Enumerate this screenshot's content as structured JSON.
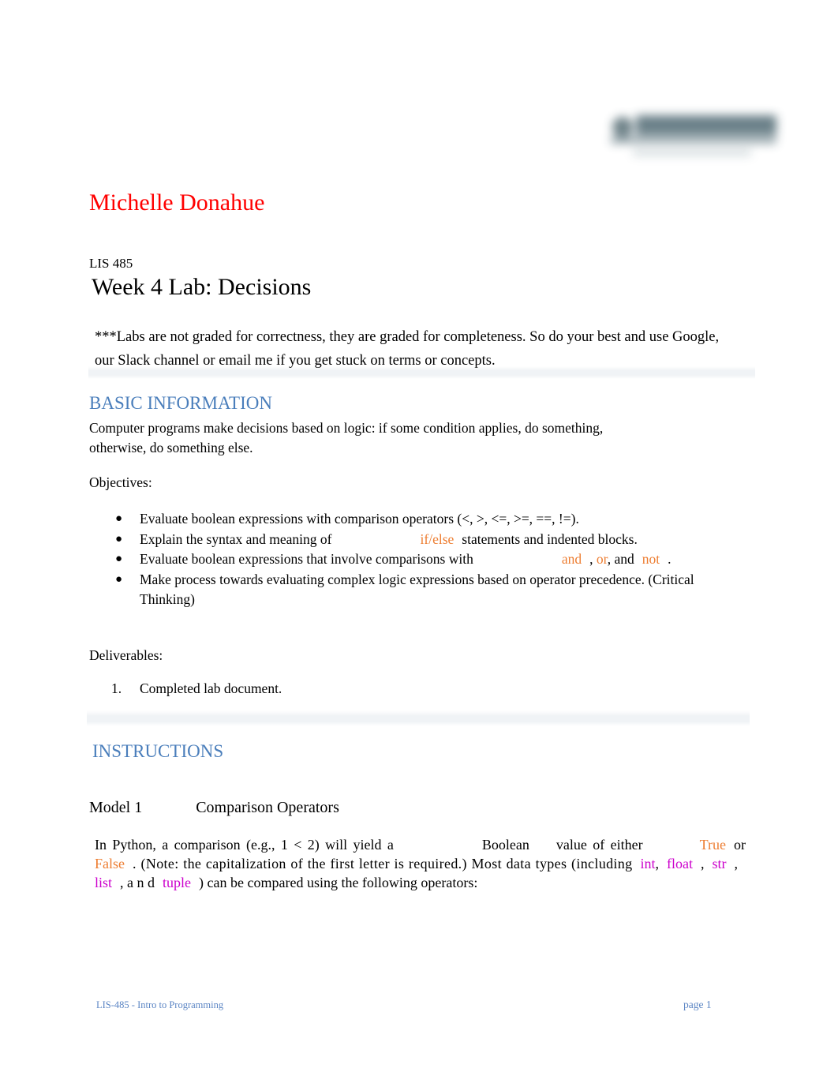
{
  "document": {
    "author": "Michelle Donahue",
    "course_id": "LIS 485",
    "title": "Week 4 Lab: Decisions",
    "note": "***Labs are not graded for correctness, they are graded for completeness. So do your best and use Google, our Slack channel or email me if you get stuck on terms or concepts."
  },
  "logo": {
    "name": "university-logo",
    "state": "blurred",
    "color": "#5f767f"
  },
  "basic_information": {
    "heading": "BASIC INFORMATION",
    "intro": "Computer programs make decisions based on logic: if some condition applies, do something, otherwise, do something else.",
    "objectives_label": "Objectives:",
    "objectives": [
      {
        "prefix": "Evaluate boolean expressions with comparison operators (<, >, <=, >=, ==, !=)."
      },
      {
        "prefix": "Explain the syntax and meaning of",
        "code_if": "if",
        "code_slash": "/",
        "code_else": "else",
        "suffix": "statements and indented blocks."
      },
      {
        "prefix": "Evaluate boolean expressions that involve comparisons with",
        "code_and": "and",
        "comma1": ",",
        "code_or": "or",
        "mid": ", and",
        "code_not": "not",
        "suffix": "."
      },
      {
        "prefix": "Make process towards evaluating complex logic expressions based on operator precedence. (Critical Thinking)"
      }
    ],
    "deliverables_label": "Deliverables:",
    "deliverables": [
      {
        "marker": "1.",
        "text": "Completed lab document."
      }
    ]
  },
  "instructions": {
    "heading": "INSTRUCTIONS",
    "model_label": "Model 1",
    "model_title": "Comparison Operators",
    "paragraph": {
      "seg1": "In Python, a comparison (e.g., 1 < 2) will yield a",
      "seg2_bold": "Boolean",
      "seg3": "value of either",
      "code_true": "True",
      "seg4": "or",
      "code_false": "False",
      "seg5": ". (Note: the capitalization of the first letter is required.) Most data types (including",
      "code_int": "int",
      "c1": ",",
      "code_float": "float",
      "c2": ",",
      "code_str": "str",
      "c3": ",",
      "code_list": "list",
      "c4": ", a n d",
      "code_tuple": "tuple",
      "seg6": ") can be compared using the following operators:"
    }
  },
  "footer": {
    "left": "LIS-485 - Intro to Programming",
    "right": "page 1"
  },
  "colors": {
    "author_red": "#ff0000",
    "heading_blue": "#4a7ebb",
    "keyword_orange": "#ed7d31",
    "type_magenta": "#cc00cc",
    "footer_blue": "#5b85c4"
  }
}
